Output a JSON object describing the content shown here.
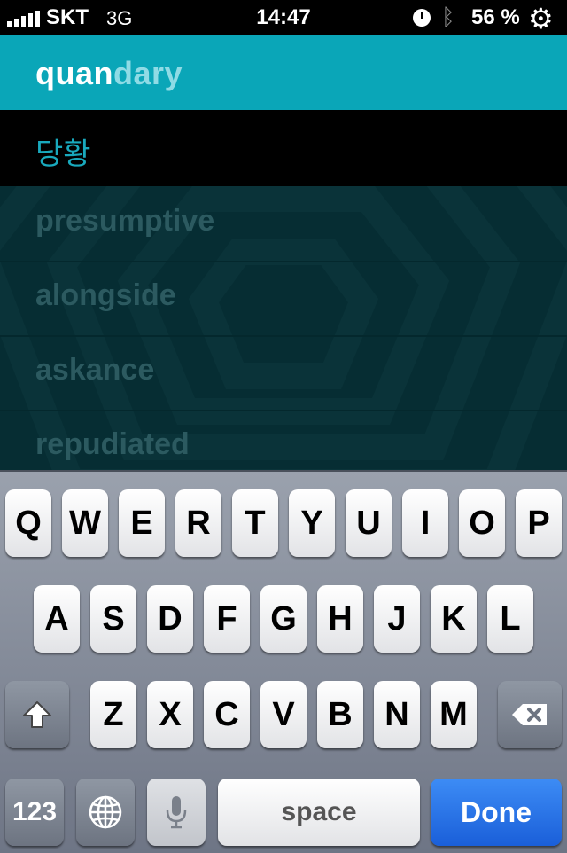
{
  "status_bar": {
    "carrier": "SKT",
    "network": "3G",
    "time": "14:47",
    "battery": "56 %",
    "icons": [
      "signal-icon",
      "clock-icon",
      "bluetooth-icon",
      "gear-icon"
    ]
  },
  "search": {
    "typed": "quan",
    "suggestion": "dary"
  },
  "results": {
    "translation": "당황",
    "words": [
      "presumptive",
      "alongside",
      "askance",
      "repudiated"
    ]
  },
  "keyboard": {
    "row1": [
      "Q",
      "W",
      "E",
      "R",
      "T",
      "Y",
      "U",
      "I",
      "O",
      "P"
    ],
    "row2": [
      "A",
      "S",
      "D",
      "F",
      "G",
      "H",
      "J",
      "K",
      "L"
    ],
    "row3": [
      "Z",
      "X",
      "C",
      "V",
      "B",
      "N",
      "M"
    ],
    "numbers_label": "123",
    "space_label": "space",
    "done_label": "Done"
  },
  "colors": {
    "header_bg": "#0aa6b8",
    "translation_text": "#19a9bd",
    "done_key": "#1a5fd9"
  }
}
